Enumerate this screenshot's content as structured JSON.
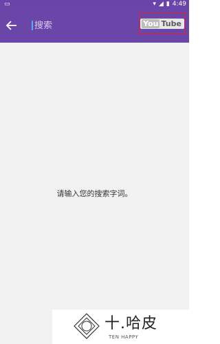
{
  "status_bar": {
    "time": "4:49",
    "icons": [
      "wifi-icon",
      "signal-icon",
      "battery-icon"
    ]
  },
  "toolbar": {
    "back_icon": "arrow-left-icon",
    "search_placeholder": "搜索",
    "youtube_logo": {
      "you": "You",
      "tube": "Tube"
    }
  },
  "content": {
    "hint": "请输入您的搜索字词。"
  },
  "watermark": {
    "title": "十.哈皮",
    "subtitle": "TEN HAPPY"
  },
  "colors": {
    "appbar": "#6b46a9",
    "background": "#f1f1f1",
    "highlight_box": "#e2202a"
  }
}
